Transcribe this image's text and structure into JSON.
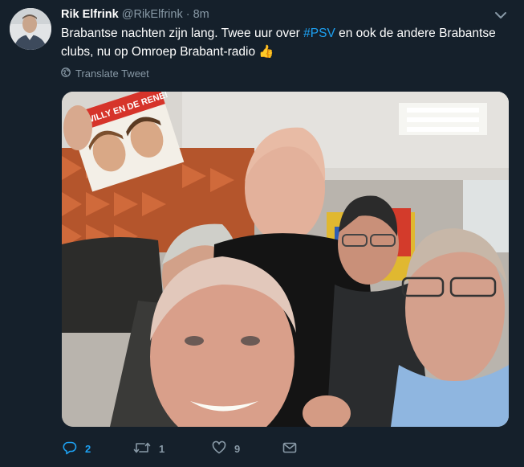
{
  "tweet": {
    "author_name": "Rik Elfrink",
    "author_handle": "@RikElfrink",
    "separator": "·",
    "time": "8m",
    "text_before_tag": "Brabantse nachten zijn lang. Twee uur over ",
    "hashtag": "#PSV",
    "text_after_tag": " en ook de andere Brabantse clubs, nu op Omroep Brabant-radio ",
    "emoji": "👍",
    "translate_label": "Translate Tweet",
    "photo_sign_text": "BEN WILLY EN DE RENE!"
  },
  "actions": {
    "reply_count": "2",
    "retweet_count": "1",
    "like_count": "9"
  },
  "colors": {
    "background": "#15202b",
    "accent": "#1da1f2",
    "muted": "#8899a6"
  },
  "icons": [
    "avatar",
    "chevron-down-icon",
    "globe-icon",
    "reply-icon",
    "retweet-icon",
    "heart-icon",
    "share-icon"
  ]
}
